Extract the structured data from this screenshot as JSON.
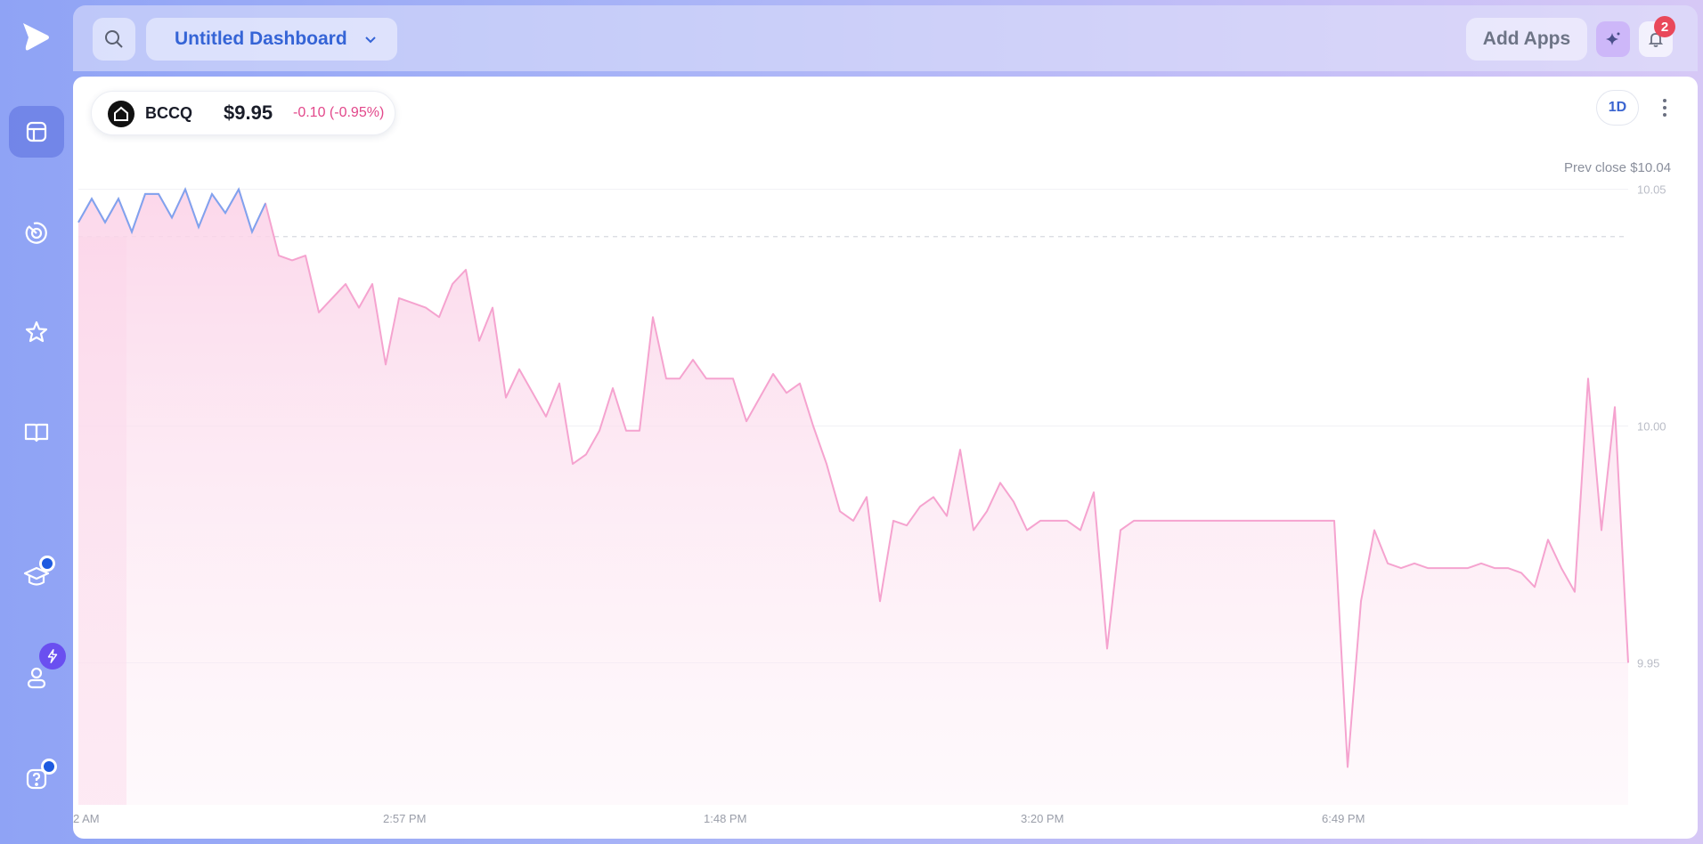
{
  "sidebar": {
    "logo_icon": "play-logo-icon",
    "items": [
      {
        "name": "dashboard",
        "icon": "dashboard-icon",
        "active": true
      },
      {
        "name": "radar",
        "icon": "radar-icon",
        "active": false
      },
      {
        "name": "watchlist",
        "icon": "star-icon",
        "active": false
      },
      {
        "name": "learn",
        "icon": "book-icon",
        "active": false
      },
      {
        "name": "education",
        "icon": "graduation-cap-icon",
        "active": false,
        "badge": "dot"
      },
      {
        "name": "profile",
        "icon": "user-icon",
        "active": false,
        "badge": "bolt"
      },
      {
        "name": "help",
        "icon": "help-icon",
        "active": false,
        "badge": "dot"
      }
    ]
  },
  "topbar": {
    "dashboard_title": "Untitled Dashboard",
    "add_apps_label": "Add Apps",
    "notification_count": "2"
  },
  "ticker": {
    "symbol": "BCCQ",
    "price": "$9.95",
    "change": "-0.10 (-0.95%)",
    "period": "1D",
    "prev_close_label": "Prev close $10.04"
  },
  "colors": {
    "accent": "#3564d6",
    "negative": "#e2478a",
    "line_pink": "#f5a3cf",
    "line_blue": "#7fa3ef",
    "badge_red": "#e9485a"
  },
  "chart_data": {
    "type": "area",
    "title": "",
    "xlabel": "",
    "ylabel": "",
    "ylim": [
      9.92,
      10.055
    ],
    "prev_close": 10.04,
    "y_ticks": [
      "10.05",
      "10.00",
      "9.95"
    ],
    "x_tick_labels": [
      "2 AM",
      "2:57 PM",
      "1:48 PM",
      "3:20 PM",
      "6:49 PM"
    ],
    "series": [
      {
        "values": [
          10.043,
          10.048,
          10.043,
          10.048,
          10.041,
          10.049,
          10.049,
          10.044,
          10.05,
          10.042,
          10.049,
          10.045,
          10.05,
          10.041,
          10.047,
          10.036,
          10.035,
          10.036,
          10.024,
          10.027,
          10.03,
          10.025,
          10.03,
          10.013,
          10.027,
          10.026,
          10.025,
          10.023,
          10.03,
          10.033,
          10.018,
          10.025,
          10.006,
          10.012,
          10.007,
          10.002,
          10.009,
          9.992,
          9.994,
          9.999,
          10.008,
          9.999,
          9.999,
          10.023,
          10.01,
          10.01,
          10.014,
          10.01,
          10.01,
          10.01,
          10.001,
          10.006,
          10.011,
          10.007,
          10.009,
          10.0,
          9.992,
          9.982,
          9.98,
          9.985,
          9.963,
          9.98,
          9.979,
          9.983,
          9.985,
          9.981,
          9.995,
          9.978,
          9.982,
          9.988,
          9.984,
          9.978,
          9.98,
          9.98,
          9.98,
          9.978,
          9.986,
          9.953,
          9.978,
          9.98,
          9.98,
          9.98,
          9.98,
          9.98,
          9.98,
          9.98,
          9.98,
          9.98,
          9.98,
          9.98,
          9.98,
          9.98,
          9.98,
          9.98,
          9.98,
          9.928,
          9.963,
          9.978,
          9.971,
          9.97,
          9.971,
          9.97,
          9.97,
          9.97,
          9.97,
          9.971,
          9.97,
          9.97,
          9.969,
          9.966,
          9.976,
          9.97,
          9.965,
          10.01,
          9.978,
          10.004,
          9.95
        ]
      }
    ]
  }
}
